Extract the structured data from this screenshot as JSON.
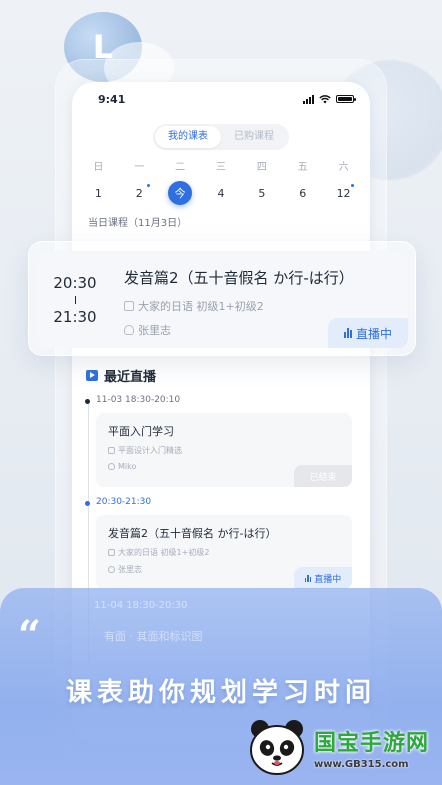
{
  "bubble_letter": "L",
  "status": {
    "time": "9:41"
  },
  "tabs": [
    {
      "label": "我的课表",
      "active": true
    },
    {
      "label": "已购课程",
      "active": false
    }
  ],
  "week": {
    "days": [
      "日",
      "一",
      "二",
      "三",
      "四",
      "五",
      "六"
    ],
    "dates": [
      "1",
      "2",
      "今",
      "4",
      "5",
      "6",
      "12"
    ],
    "dot_after": [
      1,
      6
    ]
  },
  "today_label": "当日课程（11月3日）",
  "featured_course": {
    "start": "20:30",
    "separator": "I",
    "end": "21:30",
    "title": "发音篇2（五十音假名 か行-は行）",
    "book": "大家的日语 初级1+初级2",
    "teacher": "张里志",
    "status": "直播中"
  },
  "recent": {
    "heading": "最近直播",
    "items": [
      {
        "time": "11-03 18:30-20:10",
        "title": "平面入门学习",
        "book": "平面设计入门精选",
        "teacher": "Miko",
        "status": "已结束",
        "state": "ended"
      },
      {
        "time": "20:30-21:30",
        "title": "发音篇2（五十音假名 か行-は行）",
        "book": "大家的日语 初级1+初级2",
        "teacher": "张里志",
        "status": "直播中",
        "state": "live"
      }
    ]
  },
  "banner": {
    "quote": "“",
    "slogan": "课表助你规划学习时间",
    "ghost_time": "11-04 18:30-20:30",
    "ghost_title": "有面 · 其面和标识图"
  },
  "watermark": {
    "brand": "国宝手游网",
    "url": "www.GB315.com"
  },
  "colors": {
    "accent": "#2f6fe0",
    "banner": "#8cace e",
    "watermark_green": "#2da83a"
  }
}
